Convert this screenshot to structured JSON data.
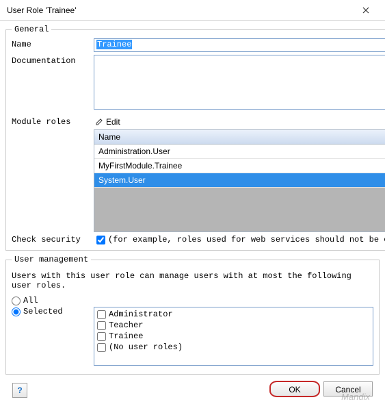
{
  "titlebar": {
    "title": "User Role 'Trainee'"
  },
  "general": {
    "legend": "General",
    "name_label": "Name",
    "name_value": "Trainee",
    "doc_label": "Documentation",
    "doc_value": "",
    "module_roles_label": "Module roles",
    "edit_label": "Edit",
    "table_header": "Name",
    "module_roles": [
      {
        "name": "Administration.User",
        "selected": false
      },
      {
        "name": "MyFirstModule.Trainee",
        "selected": false
      },
      {
        "name": "System.User",
        "selected": true
      }
    ],
    "check_security_label": "Check security",
    "check_security_checked": true,
    "check_security_desc": "(for example, roles used for web services should not be checked for sec"
  },
  "user_management": {
    "legend": "User management",
    "desc": "Users with this user role can manage users with at most the following user roles.",
    "option_all": "All",
    "option_selected": "Selected",
    "selected_option": "Selected",
    "roles": [
      {
        "label": "Administrator",
        "checked": false
      },
      {
        "label": "Teacher",
        "checked": false
      },
      {
        "label": "Trainee",
        "checked": false
      },
      {
        "label": "(No user roles)",
        "checked": false
      }
    ]
  },
  "buttons": {
    "ok": "OK",
    "cancel": "Cancel"
  },
  "help_icon": "?",
  "watermark": "Mandix"
}
